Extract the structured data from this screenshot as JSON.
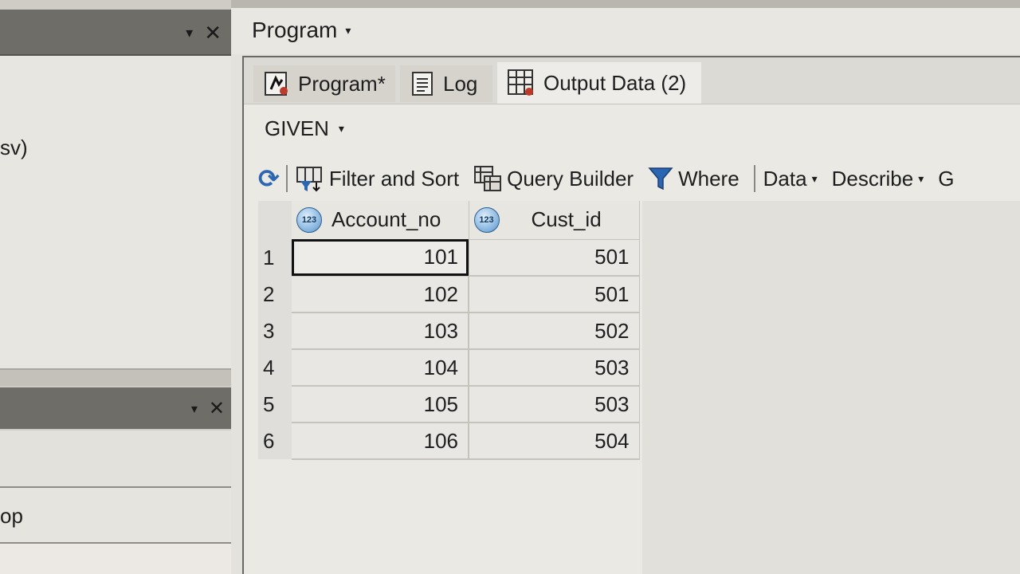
{
  "left_panel": {
    "top_fragment": "sv)",
    "bottom_fragment": "op",
    "ctrl_dropdown": "▾",
    "ctrl_close": "✕"
  },
  "program_header": {
    "title": "Program",
    "caret": "▾"
  },
  "tabs": [
    {
      "label": "Program*"
    },
    {
      "label": "Log"
    },
    {
      "label": "Output Data (2)"
    }
  ],
  "dataset": {
    "name": "GIVEN",
    "caret": "▾"
  },
  "toolbar": {
    "refresh_icon": "⟳",
    "filter_sort_label": "Filter and Sort",
    "query_builder_label": "Query Builder",
    "where_label": "Where",
    "data_label": "Data",
    "describe_label": "Describe",
    "overflow_label": "G",
    "caret": "▾"
  },
  "table": {
    "columns": [
      {
        "name": "Account_no",
        "type_icon": "123"
      },
      {
        "name": "Cust_id",
        "type_icon": "123"
      }
    ],
    "rows": [
      {
        "num": "1",
        "account_no": "101",
        "cust_id": "501"
      },
      {
        "num": "2",
        "account_no": "102",
        "cust_id": "501"
      },
      {
        "num": "3",
        "account_no": "103",
        "cust_id": "502"
      },
      {
        "num": "4",
        "account_no": "104",
        "cust_id": "503"
      },
      {
        "num": "5",
        "account_no": "105",
        "cust_id": "503"
      },
      {
        "num": "6",
        "account_no": "106",
        "cust_id": "504"
      }
    ]
  }
}
